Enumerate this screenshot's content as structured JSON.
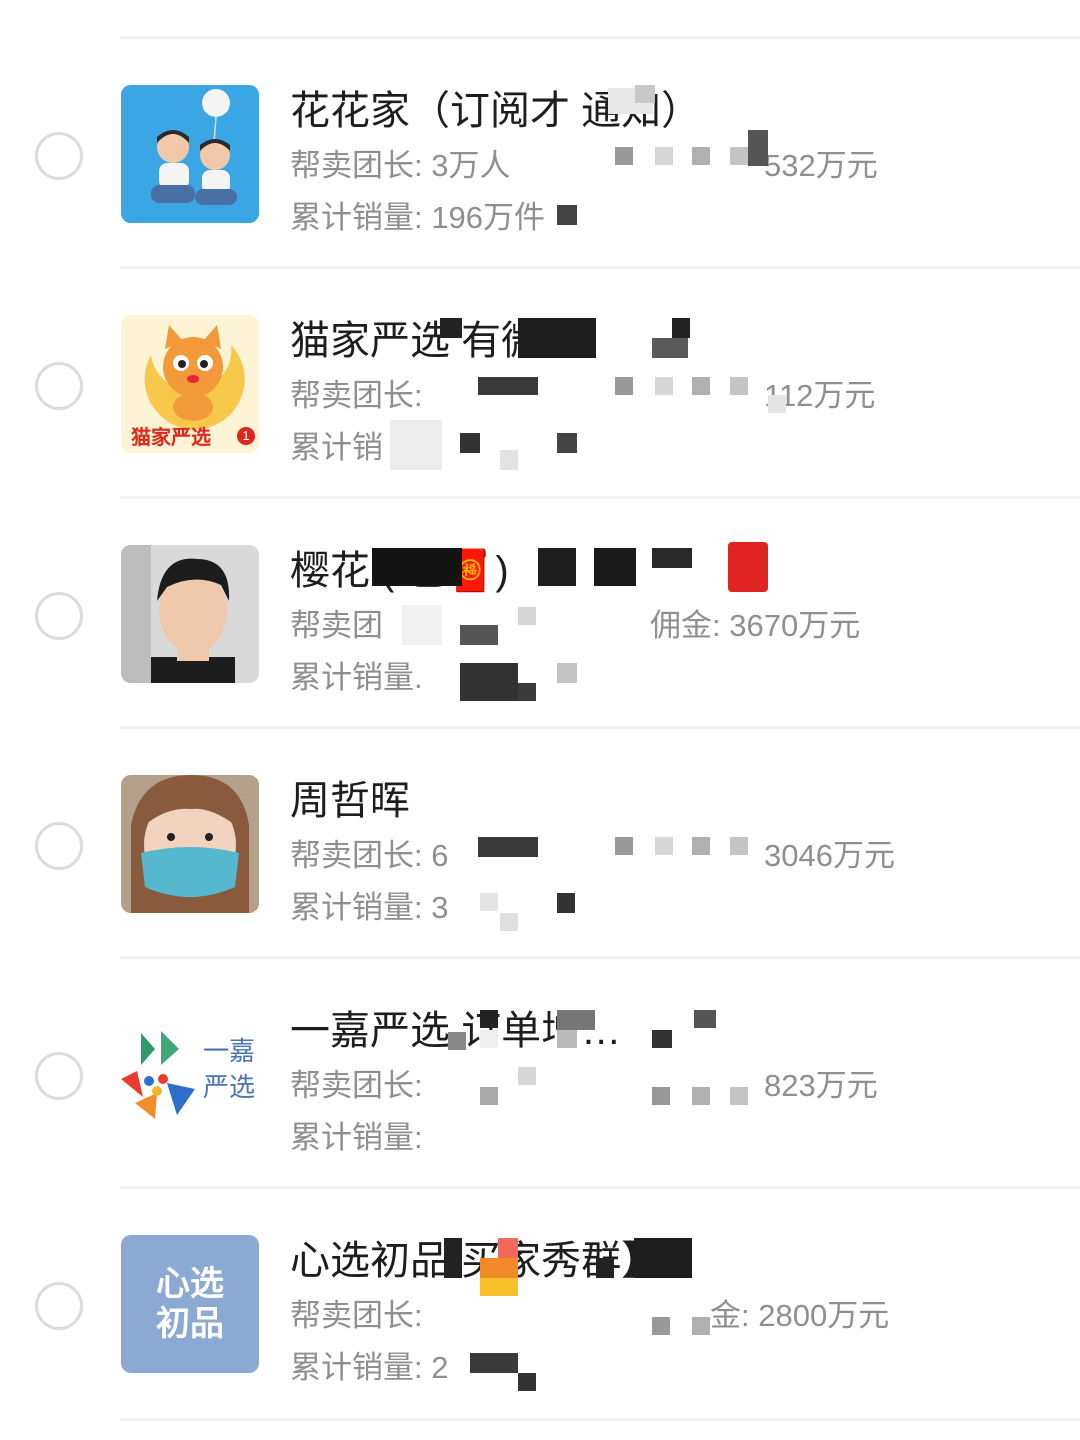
{
  "rows": [
    {
      "title": "花花家（订阅才 通知）",
      "line1_left": "帮卖团长: 3万人",
      "line1_right": "532万元",
      "line2": "累计销量: 196万件",
      "avatar": "photo-two-boys-balloon"
    },
    {
      "title": "猫家严选 有微信】",
      "line1_left": "帮卖团长:",
      "line1_right": "112万元",
      "line2": "累计销",
      "avatar": "cat-logo",
      "avatar_text": "猫家严选",
      "avatar_badge": "1"
    },
    {
      "title": "樱花 ( 包🧧)",
      "line1_left": "帮卖团",
      "line1_right": "佣金: 3670万元",
      "line2": "累计销量.",
      "avatar": "photo-man"
    },
    {
      "title": "周哲晖",
      "line1_left": "帮卖团长: 6",
      "line1_right": "3046万元",
      "line2": "累计销量: 3",
      "avatar": "photo-woman-mask"
    },
    {
      "title": "一嘉严选 订单增…",
      "line1_left": "帮卖团长:",
      "line1_right": "823万元",
      "line2": "累计销量:",
      "avatar": "yijia-logo",
      "avatar_text_1": "一嘉",
      "avatar_text_2": "严选"
    },
    {
      "title": "心选初品 买家秀群】",
      "line1_left": "帮卖团长:",
      "line1_right": "金: 2800万元",
      "line2": "累计销量: 2",
      "avatar": "xinxuan-logo",
      "avatar_text_1": "心选",
      "avatar_text_2": "初品"
    }
  ],
  "colors": {
    "title": "#1d1d1d",
    "subtext": "#8f8f8f",
    "radio_border": "#dcdcdc",
    "divider": "#f1f1f1"
  }
}
